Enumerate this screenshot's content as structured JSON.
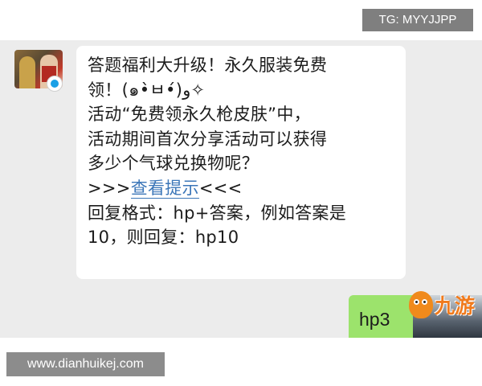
{
  "overlay": {
    "tg_tag": "TG: MYYJJPP"
  },
  "incoming_message": {
    "lines": [
      "答题福利大升级！永久服装免费",
      "领！(๑•̀ㅂ•́)و✧",
      "活动“免费领永久枪皮肤”中，",
      "活动期间首次分享活动可以获得",
      "多少个气球兑换物呢？"
    ],
    "hint_prefix": ">>>",
    "hint_link": "查看提示",
    "hint_suffix": "<<<",
    "format_lines": [
      "回复格式：hp+答案，例如答案是",
      "10，则回复：hp10"
    ]
  },
  "outgoing_message": {
    "text": "hp3"
  },
  "brand_logo": {
    "text": "九游",
    "color": "#f07a1c"
  },
  "watermark": {
    "text": "www.dianhuikej.com"
  },
  "colors": {
    "chat_bg": "#ececec",
    "reply_bubble": "#9ce36c",
    "link": "#3b76b8"
  }
}
